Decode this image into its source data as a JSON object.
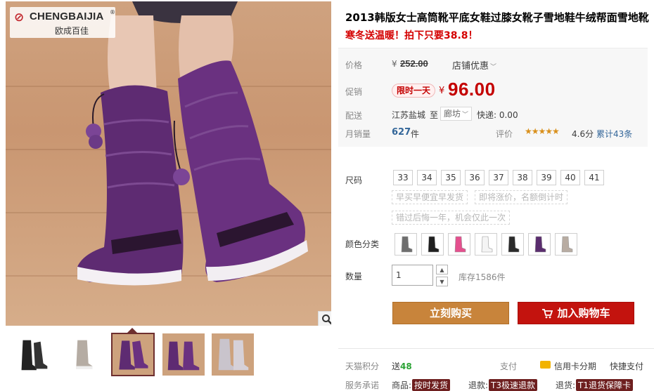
{
  "brand": {
    "name": "CHENGBAIJIA",
    "mark": "®",
    "cn_name": "欧成百佳"
  },
  "product": {
    "title": "2013韩版女士高筒靴平底女鞋过膝女靴子雪地鞋牛绒帮面雪地靴",
    "subtitle": "寒冬送温暖！拍下只要38.8！"
  },
  "pricing": {
    "price_label": "价格",
    "currency": "¥",
    "original_price": "252.00",
    "store_discount": "店铺优惠",
    "promo_label": "促销",
    "promo_badge": "限时一天",
    "promo_price": "96.00"
  },
  "shipping": {
    "label": "配送",
    "from": "江苏盐城",
    "to_word": "至",
    "destination": "廊坊",
    "fee": "快递: 0.00"
  },
  "sales": {
    "label": "月销量",
    "count": "627",
    "unit": "件",
    "rating_label": "评价",
    "stars": 4.6,
    "score": "4.6分",
    "reviews": "累计43条"
  },
  "size": {
    "label": "尺码",
    "options": [
      "33",
      "34",
      "35",
      "36",
      "37",
      "38",
      "39",
      "40",
      "41"
    ],
    "notes": [
      "早买早便宜早发货",
      "即将涨价，名额倒计时",
      "错过后悔一年，机会仅此一次"
    ]
  },
  "color": {
    "label": "颜色分类",
    "swatches": [
      "gray",
      "black",
      "pink",
      "white",
      "black-low",
      "purple",
      "beige"
    ]
  },
  "quantity": {
    "label": "数量",
    "value": "1",
    "stock": "库存1586件"
  },
  "actions": {
    "buy_now": "立刻购买",
    "add_cart": "加入购物车"
  },
  "benefits": {
    "points_label": "天猫积分",
    "points_prefix": "送",
    "points_value": "48",
    "pay_label": "支付",
    "credit": "信用卡分期",
    "quick_pay": "快捷支付"
  },
  "service": {
    "label": "服务承诺",
    "items": [
      {
        "prefix": "商品:",
        "tag": "按时发货"
      },
      {
        "prefix": "退款:",
        "tag": "T3极速退款"
      },
      {
        "prefix": "退货:",
        "tag": "T1退货保障卡"
      }
    ]
  },
  "colors": {
    "accent": "#c40000",
    "buy": "#c8843b",
    "cart": "#c3130e",
    "link": "#336699",
    "boot": "#5a2d6e"
  }
}
